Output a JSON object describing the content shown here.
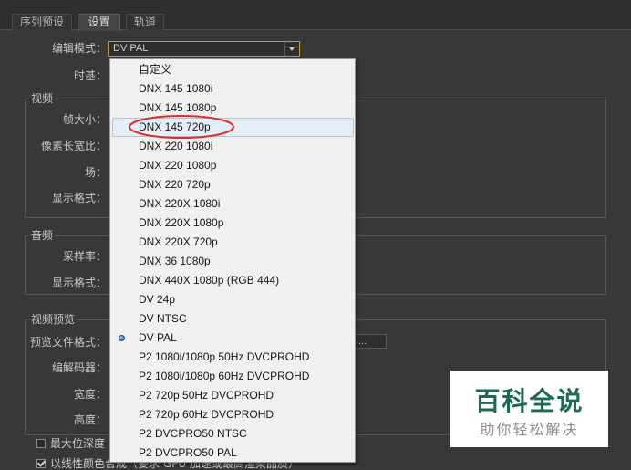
{
  "colors": {
    "panel_bg": "#383838",
    "focus_border": "#c89a3c",
    "menu_highlight_bg": "#e4eef9",
    "menu_highlight_border": "#a9c6e6",
    "annotation_red": "#d9302c",
    "watermark_text": "#1b6a57"
  },
  "tabs": [
    {
      "label": "序列预设",
      "active": false
    },
    {
      "label": "设置",
      "active": true
    },
    {
      "label": "轨道",
      "active": false
    }
  ],
  "editing_mode": {
    "label": "编辑模式：",
    "value": "DV PAL",
    "icon": "chevron-down-icon"
  },
  "timebase": {
    "label": "时基："
  },
  "video": {
    "legend": "视频",
    "frame_size_label": "帧大小：",
    "pixel_aspect_label": "像素长宽比：",
    "fields_label": "场：",
    "display_format_label": "显示格式："
  },
  "audio": {
    "legend": "音频",
    "sample_rate_label": "采样率：",
    "display_format_label": "显示格式："
  },
  "preview": {
    "legend": "视频预览",
    "file_format_label": "预览文件格式：",
    "file_format_value": "...",
    "codec_label": "编解码器：",
    "width_label": "宽度：",
    "height_label": "高度："
  },
  "options": {
    "max_bit_depth": {
      "label": "最大位深度",
      "checked": false
    },
    "linear_color": {
      "label": "以线性颜色合成（要求 GPU 加速或最高渲染品质）",
      "checked": true
    }
  },
  "dropdown": {
    "items": [
      {
        "label": "自定义"
      },
      {
        "label": "DNX 145 1080i"
      },
      {
        "label": "DNX 145 1080p"
      },
      {
        "label": "DNX 145 720p",
        "highlighted": true
      },
      {
        "label": "DNX 220 1080i"
      },
      {
        "label": "DNX 220 1080p"
      },
      {
        "label": "DNX 220 720p"
      },
      {
        "label": "DNX 220X 1080i"
      },
      {
        "label": "DNX 220X 1080p"
      },
      {
        "label": "DNX 220X 720p"
      },
      {
        "label": "DNX 36 1080p"
      },
      {
        "label": "DNX 440X 1080p (RGB 444)"
      },
      {
        "label": "DV 24p"
      },
      {
        "label": "DV NTSC"
      },
      {
        "label": "DV PAL",
        "checked": true
      },
      {
        "label": "P2 1080i/1080p 50Hz DVCPROHD"
      },
      {
        "label": "P2 1080i/1080p 60Hz DVCPROHD"
      },
      {
        "label": "P2 720p 50Hz DVCPROHD"
      },
      {
        "label": "P2 720p 60Hz DVCPROHD"
      },
      {
        "label": "P2 DVCPRO50 NTSC"
      },
      {
        "label": "P2 DVCPRO50 PAL"
      }
    ]
  },
  "watermark": {
    "title": "百科全说",
    "subtitle": "助你轻松解决"
  }
}
